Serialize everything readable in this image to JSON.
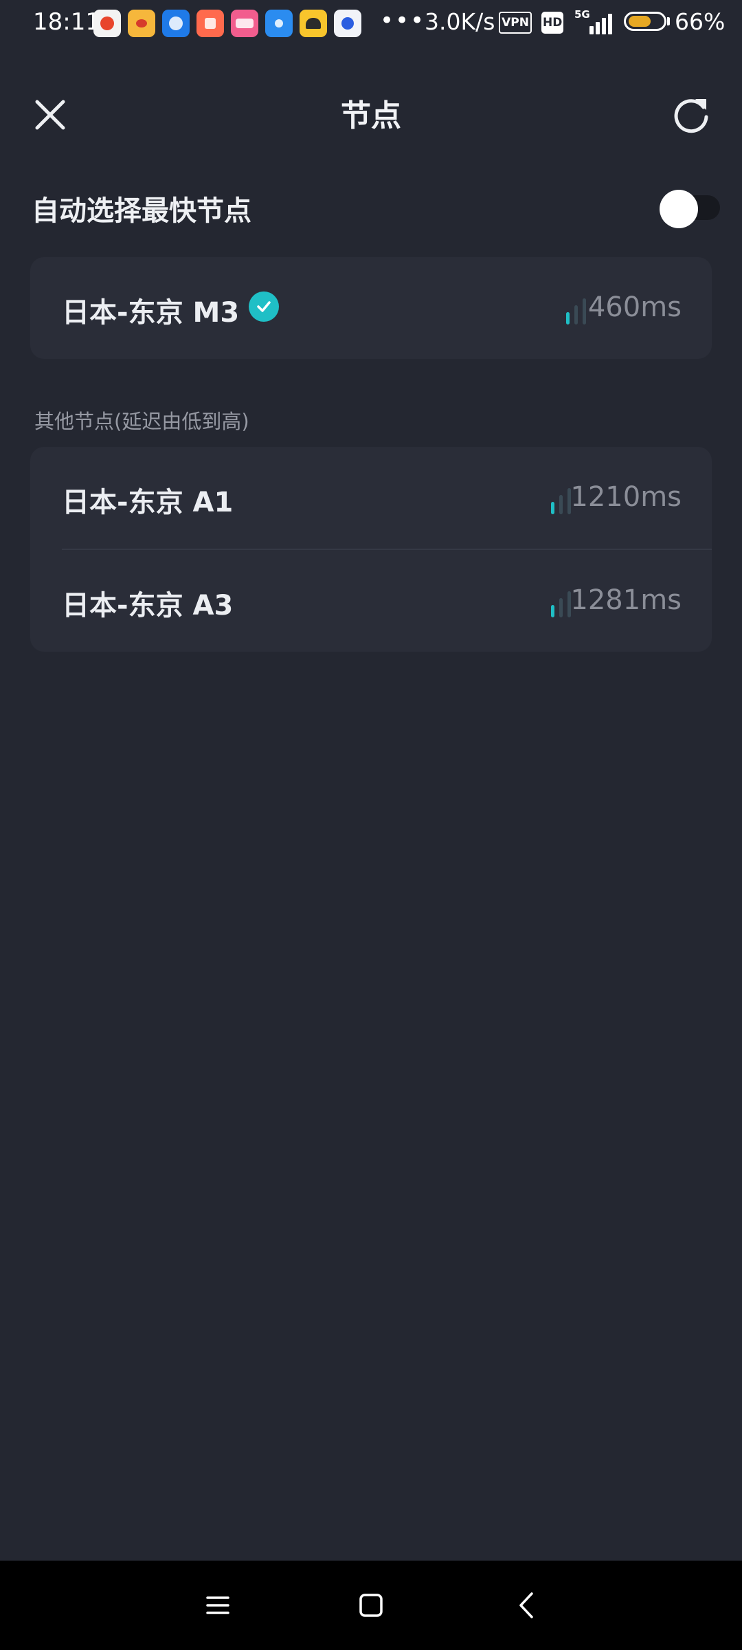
{
  "status_bar": {
    "time": "18:11",
    "more_indicator": "•••",
    "net_speed": "3.0K/s",
    "vpn_badge": "VPN",
    "hd_badge": "HD",
    "network_type": "5G",
    "battery_percent": "66%",
    "battery_level": 0.66,
    "app_icons": [
      {
        "name": "pinduoduo-icon",
        "color": "#f3f3f3"
      },
      {
        "name": "weibo-icon",
        "color": "#f6b73c"
      },
      {
        "name": "qq-icon",
        "color": "#1f7ae8"
      },
      {
        "name": "taobao-icon",
        "color": "#ff6a4d"
      },
      {
        "name": "bilibili-icon",
        "color": "#f25d8e"
      },
      {
        "name": "hotspot-icon",
        "color": "#2b8cf0"
      },
      {
        "name": "app-yellow-icon",
        "color": "#f8c52c"
      },
      {
        "name": "baidu-icon",
        "color": "#f1f3f8"
      }
    ]
  },
  "header": {
    "title": "节点",
    "close_icon": "close-icon",
    "refresh_icon": "refresh-icon"
  },
  "auto_select": {
    "label": "自动选择最快节点",
    "enabled": false
  },
  "current_node": {
    "name": "日本-东京 M3",
    "selected": true,
    "latency": "460ms",
    "signal_level": 1
  },
  "other_nodes_label": "其他节点(延迟由低到高)",
  "other_nodes": [
    {
      "name": "日本-东京 A1",
      "latency": "1210ms",
      "signal_level": 1
    },
    {
      "name": "日本-东京 A3",
      "latency": "1281ms",
      "signal_level": 1
    }
  ],
  "colors": {
    "background": "#242731",
    "card": "#2a2d38",
    "accent": "#1fbfc6",
    "muted_text": "#8b8e98"
  },
  "nav_bar": {
    "menu_icon": "menu-icon",
    "home_icon": "home-icon",
    "back_icon": "back-icon"
  }
}
